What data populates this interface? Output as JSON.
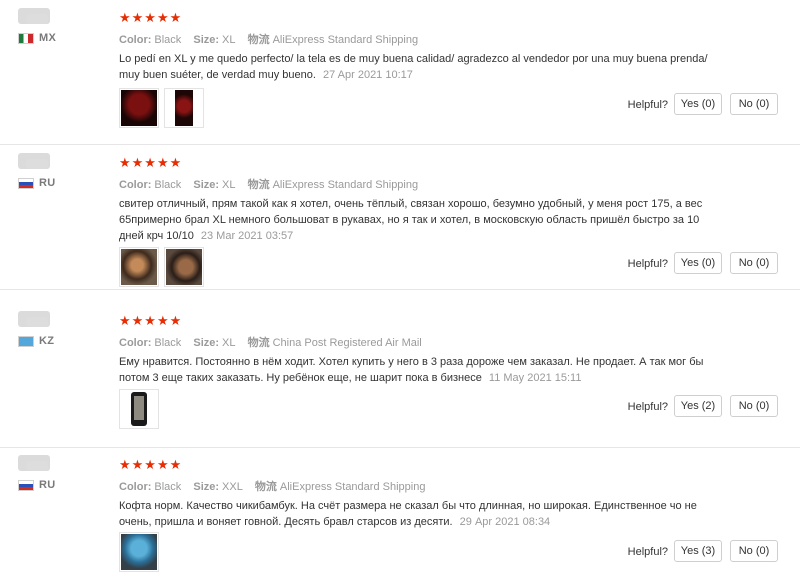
{
  "labels": {
    "color": "Color:",
    "size": "Size:",
    "logistics": "物流",
    "helpful": "Helpful?"
  },
  "reviews": [
    {
      "country_code": "MX",
      "stars": "★★★★★",
      "color_value": "Black",
      "size_value": "XL",
      "shipping": "AliExpress Standard Shipping",
      "text": "Lo pedí en XL y me quedo perfecto/ la tela es de muy buena calidad/ agradezco al vendedor por una muy buena prenda/ muy buen suéter, de verdad muy bueno.",
      "date": "27 Apr 2021 10:17",
      "yes_label": "Yes (0)",
      "no_label": "No (0)"
    },
    {
      "country_code": "RU",
      "stars": "★★★★★",
      "color_value": "Black",
      "size_value": "XL",
      "shipping": "AliExpress Standard Shipping",
      "text": "свитер отличный, прям такой как я хотел, очень тёплый, связан хорошо, безумно удобный, у меня рост 175, а вес 65примерно брал XL немного большоват в рукавах, но я так и хотел, в московскую область пришёл быстро за 10 дней крч 10/10",
      "date": "23 Mar 2021 03:57",
      "yes_label": "Yes (0)",
      "no_label": "No (0)"
    },
    {
      "country_code": "KZ",
      "stars": "★★★★★",
      "color_value": "Black",
      "size_value": "XL",
      "shipping": "China Post Registered Air Mail",
      "text": "Ему нравится. Постоянно в нём ходит. Хотел купить у него в 3 раза дороже чем заказал. Не продает. А так мог бы потом 3 еще таких заказать. Ну ребёнок еще, не шарит пока в бизнесе",
      "date": "11 May 2021 15:11",
      "yes_label": "Yes (2)",
      "no_label": "No (0)"
    },
    {
      "country_code": "RU",
      "stars": "★★★★★",
      "color_value": "Black",
      "size_value": "XXL",
      "shipping": "AliExpress Standard Shipping",
      "text": "Кофта норм. Качество чикибамбук. На счёт размера не сказал бы что длинная, но широкая. Единственное чо не очень, пришла и воняет говной. Десять бравл старсов из десяти.",
      "date": "29 Apr 2021 08:34",
      "yes_label": "Yes (3)",
      "no_label": "No (0)"
    }
  ],
  "colors": {
    "star": "#e62e04",
    "muted": "#9a9a9a",
    "divider": "#e6e6e6"
  },
  "icons": {
    "flag_mx": "mexico-flag-icon",
    "flag_ru": "russia-flag-icon",
    "flag_kz": "kazakhstan-flag-icon"
  }
}
